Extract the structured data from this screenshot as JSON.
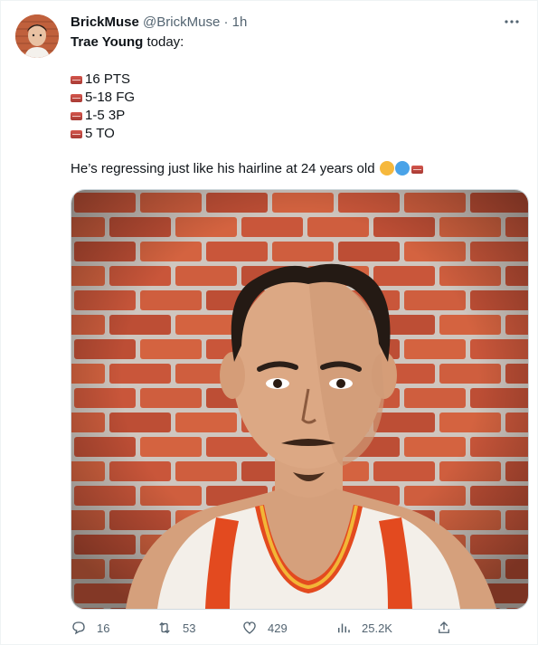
{
  "tweet": {
    "author_name": "BrickMuse",
    "author_handle": "@BrickMuse",
    "separator": "·",
    "time": "1h",
    "lead_bold": "Trae Young",
    "lead_rest": " today:",
    "stats": [
      "16 PTS",
      "5-18 FG",
      "1-5 3P",
      "5 TO"
    ],
    "closing": "He’s regressing just like his hairline at 24 years old"
  },
  "actions": {
    "replies": "16",
    "retweets": "53",
    "likes": "429",
    "views": "25.2K"
  },
  "icons": [
    "more-icon",
    "reply-icon",
    "retweet-icon",
    "like-icon",
    "views-icon",
    "share-icon",
    "brick-emoji-icon",
    "angry-face-emoji-icon",
    "cold-face-emoji-icon"
  ],
  "colors": {
    "text": "#0f1419",
    "secondary": "#536471",
    "brick": "#c4553a",
    "mortar": "#d8cfc8"
  }
}
